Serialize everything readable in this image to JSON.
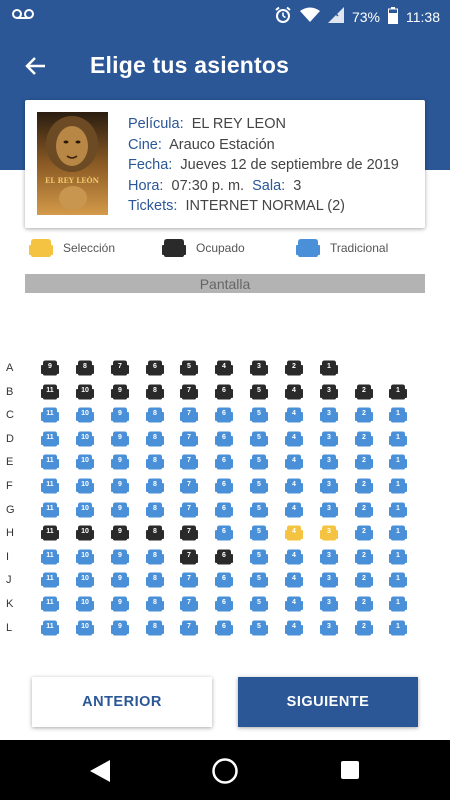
{
  "status_bar": {
    "battery": "73%",
    "time": "11:38"
  },
  "header": {
    "title": "Elige tus asientos"
  },
  "movie": {
    "pelicula_label": "Película:",
    "pelicula": "EL REY LEON",
    "cine_label": "Cine:",
    "cine": "Arauco Estación",
    "fecha_label": "Fecha:",
    "fecha": "Jueves 12 de septiembre de 2019",
    "hora_label": "Hora:",
    "hora": "07:30 p. m.",
    "sala_label": "Sala:",
    "sala": "3",
    "tickets_label": "Tickets:",
    "tickets": "INTERNET NORMAL (2)",
    "poster_text": "EL REY LEÓN"
  },
  "legend": {
    "selection": "Selección",
    "occupied": "Ocupado",
    "traditional": "Tradicional"
  },
  "screen_label": "Pantalla",
  "colors": {
    "primary": "#2b5797",
    "selected": "#f5c342",
    "occupied": "#2a2a2a",
    "available": "#4a90d9"
  },
  "seat_map": {
    "rows": [
      {
        "label": "A",
        "seats": [
          {
            "n": "9",
            "s": "o"
          },
          {
            "n": "8",
            "s": "o"
          },
          {
            "n": "7",
            "s": "o"
          },
          {
            "n": "6",
            "s": "o"
          },
          {
            "n": "5",
            "s": "o"
          },
          {
            "n": "4",
            "s": "o"
          },
          {
            "n": "3",
            "s": "o"
          },
          {
            "n": "2",
            "s": "o"
          },
          {
            "n": "1",
            "s": "o"
          }
        ]
      },
      {
        "label": "B",
        "seats": [
          {
            "n": "11",
            "s": "o"
          },
          {
            "n": "10",
            "s": "o"
          },
          {
            "n": "9",
            "s": "o"
          },
          {
            "n": "8",
            "s": "o"
          },
          {
            "n": "7",
            "s": "o"
          },
          {
            "n": "6",
            "s": "o"
          },
          {
            "n": "5",
            "s": "o"
          },
          {
            "n": "4",
            "s": "o"
          },
          {
            "n": "3",
            "s": "o"
          },
          {
            "n": "2",
            "s": "o"
          },
          {
            "n": "1",
            "s": "o"
          }
        ]
      },
      {
        "label": "C",
        "seats": [
          {
            "n": "11",
            "s": "a"
          },
          {
            "n": "10",
            "s": "a"
          },
          {
            "n": "9",
            "s": "a"
          },
          {
            "n": "8",
            "s": "a"
          },
          {
            "n": "7",
            "s": "a"
          },
          {
            "n": "6",
            "s": "a"
          },
          {
            "n": "5",
            "s": "a"
          },
          {
            "n": "4",
            "s": "a"
          },
          {
            "n": "3",
            "s": "a"
          },
          {
            "n": "2",
            "s": "a"
          },
          {
            "n": "1",
            "s": "a"
          }
        ]
      },
      {
        "label": "D",
        "seats": [
          {
            "n": "11",
            "s": "a"
          },
          {
            "n": "10",
            "s": "a"
          },
          {
            "n": "9",
            "s": "a"
          },
          {
            "n": "8",
            "s": "a"
          },
          {
            "n": "7",
            "s": "a"
          },
          {
            "n": "6",
            "s": "a"
          },
          {
            "n": "5",
            "s": "a"
          },
          {
            "n": "4",
            "s": "a"
          },
          {
            "n": "3",
            "s": "a"
          },
          {
            "n": "2",
            "s": "a"
          },
          {
            "n": "1",
            "s": "a"
          }
        ]
      },
      {
        "label": "E",
        "seats": [
          {
            "n": "11",
            "s": "a"
          },
          {
            "n": "10",
            "s": "a"
          },
          {
            "n": "9",
            "s": "a"
          },
          {
            "n": "8",
            "s": "a"
          },
          {
            "n": "7",
            "s": "a"
          },
          {
            "n": "6",
            "s": "a"
          },
          {
            "n": "5",
            "s": "a"
          },
          {
            "n": "4",
            "s": "a"
          },
          {
            "n": "3",
            "s": "a"
          },
          {
            "n": "2",
            "s": "a"
          },
          {
            "n": "1",
            "s": "a"
          }
        ]
      },
      {
        "label": "F",
        "seats": [
          {
            "n": "11",
            "s": "a"
          },
          {
            "n": "10",
            "s": "a"
          },
          {
            "n": "9",
            "s": "a"
          },
          {
            "n": "8",
            "s": "a"
          },
          {
            "n": "7",
            "s": "a"
          },
          {
            "n": "6",
            "s": "a"
          },
          {
            "n": "5",
            "s": "a"
          },
          {
            "n": "4",
            "s": "a"
          },
          {
            "n": "3",
            "s": "a"
          },
          {
            "n": "2",
            "s": "a"
          },
          {
            "n": "1",
            "s": "a"
          }
        ]
      },
      {
        "label": "G",
        "seats": [
          {
            "n": "11",
            "s": "a"
          },
          {
            "n": "10",
            "s": "a"
          },
          {
            "n": "9",
            "s": "a"
          },
          {
            "n": "8",
            "s": "a"
          },
          {
            "n": "7",
            "s": "a"
          },
          {
            "n": "6",
            "s": "a"
          },
          {
            "n": "5",
            "s": "a"
          },
          {
            "n": "4",
            "s": "a"
          },
          {
            "n": "3",
            "s": "a"
          },
          {
            "n": "2",
            "s": "a"
          },
          {
            "n": "1",
            "s": "a"
          }
        ]
      },
      {
        "label": "H",
        "seats": [
          {
            "n": "11",
            "s": "o"
          },
          {
            "n": "10",
            "s": "o"
          },
          {
            "n": "9",
            "s": "o"
          },
          {
            "n": "8",
            "s": "o"
          },
          {
            "n": "7",
            "s": "o"
          },
          {
            "n": "6",
            "s": "a"
          },
          {
            "n": "5",
            "s": "a"
          },
          {
            "n": "4",
            "s": "s"
          },
          {
            "n": "3",
            "s": "s"
          },
          {
            "n": "2",
            "s": "a"
          },
          {
            "n": "1",
            "s": "a"
          }
        ]
      },
      {
        "label": "I",
        "seats": [
          {
            "n": "11",
            "s": "a"
          },
          {
            "n": "10",
            "s": "a"
          },
          {
            "n": "9",
            "s": "a"
          },
          {
            "n": "8",
            "s": "a"
          },
          {
            "n": "7",
            "s": "o"
          },
          {
            "n": "6",
            "s": "o"
          },
          {
            "n": "5",
            "s": "a"
          },
          {
            "n": "4",
            "s": "a"
          },
          {
            "n": "3",
            "s": "a"
          },
          {
            "n": "2",
            "s": "a"
          },
          {
            "n": "1",
            "s": "a"
          }
        ]
      },
      {
        "label": "J",
        "seats": [
          {
            "n": "11",
            "s": "a"
          },
          {
            "n": "10",
            "s": "a"
          },
          {
            "n": "9",
            "s": "a"
          },
          {
            "n": "8",
            "s": "a"
          },
          {
            "n": "7",
            "s": "a"
          },
          {
            "n": "6",
            "s": "a"
          },
          {
            "n": "5",
            "s": "a"
          },
          {
            "n": "4",
            "s": "a"
          },
          {
            "n": "3",
            "s": "a"
          },
          {
            "n": "2",
            "s": "a"
          },
          {
            "n": "1",
            "s": "a"
          }
        ]
      },
      {
        "label": "K",
        "seats": [
          {
            "n": "11",
            "s": "a"
          },
          {
            "n": "10",
            "s": "a"
          },
          {
            "n": "9",
            "s": "a"
          },
          {
            "n": "8",
            "s": "a"
          },
          {
            "n": "7",
            "s": "a"
          },
          {
            "n": "6",
            "s": "a"
          },
          {
            "n": "5",
            "s": "a"
          },
          {
            "n": "4",
            "s": "a"
          },
          {
            "n": "3",
            "s": "a"
          },
          {
            "n": "2",
            "s": "a"
          },
          {
            "n": "1",
            "s": "a"
          }
        ]
      },
      {
        "label": "L",
        "seats": [
          {
            "n": "11",
            "s": "a"
          },
          {
            "n": "10",
            "s": "a"
          },
          {
            "n": "9",
            "s": "a"
          },
          {
            "n": "8",
            "s": "a"
          },
          {
            "n": "7",
            "s": "a"
          },
          {
            "n": "6",
            "s": "a"
          },
          {
            "n": "5",
            "s": "a"
          },
          {
            "n": "4",
            "s": "a"
          },
          {
            "n": "3",
            "s": "a"
          },
          {
            "n": "2",
            "s": "a"
          },
          {
            "n": "1",
            "s": "a"
          }
        ]
      }
    ]
  },
  "buttons": {
    "prev": "ANTERIOR",
    "next": "SIGUIENTE"
  }
}
